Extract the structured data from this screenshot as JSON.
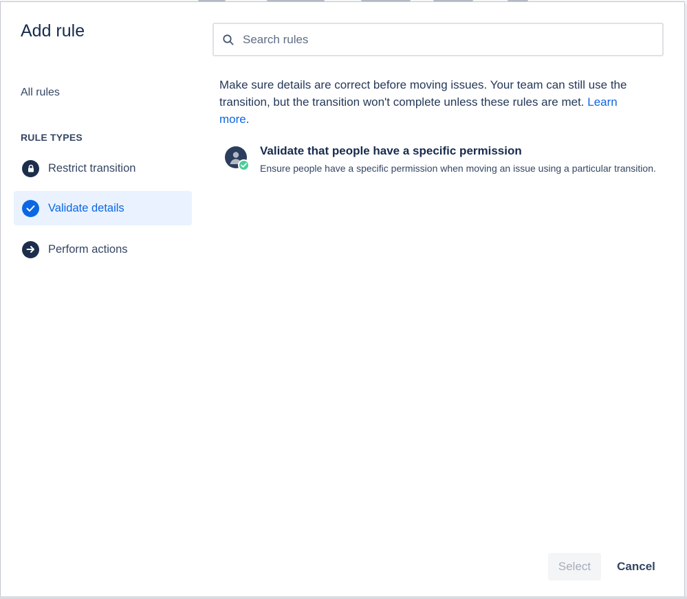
{
  "modal": {
    "title": "Add rule"
  },
  "sidebar": {
    "all_rules_label": "All rules",
    "section_heading": "RULE TYPES",
    "items": [
      {
        "label": "Restrict transition",
        "icon": "lock-icon",
        "selected": false
      },
      {
        "label": "Validate details",
        "icon": "check-icon",
        "selected": true
      },
      {
        "label": "Perform actions",
        "icon": "arrow-right-icon",
        "selected": false
      }
    ]
  },
  "search": {
    "placeholder": "Search rules",
    "value": ""
  },
  "main": {
    "description_text": "Make sure details are correct before moving issues. Your team can still use the transition, but the transition won't complete unless these rules are met. ",
    "learn_more_label": "Learn more",
    "description_suffix": ".",
    "rules": [
      {
        "title": "Validate that people have a specific permission",
        "description": "Ensure people have a specific permission when moving an issue using a particular transition.",
        "icon": "user-permission-icon"
      }
    ]
  },
  "footer": {
    "select_label": "Select",
    "cancel_label": "Cancel"
  },
  "colors": {
    "accent": "#0c66e4",
    "selected_bg": "#e9f2fe",
    "icon_dark": "#1d2e4c",
    "check_badge": "#4bce97"
  }
}
